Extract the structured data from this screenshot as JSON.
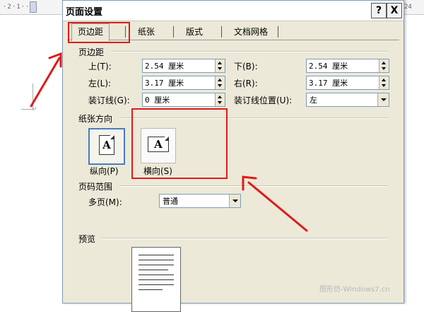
{
  "ruler": {
    "left_ticks": "·2·1··",
    "right_ticks": "24"
  },
  "dialog": {
    "title": "页面设置",
    "help_label": "?",
    "close_label": "X",
    "tabs": [
      {
        "label": "页边距",
        "active": true
      },
      {
        "label": "纸张"
      },
      {
        "label": "版式"
      },
      {
        "label": "文档网格"
      }
    ],
    "margins": {
      "section_title": "页边距",
      "top": {
        "label": "上(T):",
        "value": "2.54 厘米"
      },
      "bottom": {
        "label": "下(B):",
        "value": "2.54 厘米"
      },
      "left": {
        "label": "左(L):",
        "value": "3.17 厘米"
      },
      "right": {
        "label": "右(R):",
        "value": "3.17 厘米"
      },
      "gutter": {
        "label": "装订线(G):",
        "value": "0 厘米"
      },
      "gutter_pos": {
        "label": "装订线位置(U):",
        "value": "左"
      }
    },
    "orientation": {
      "section_title": "纸张方向",
      "portrait_label": "纵向(P)",
      "landscape_label": "横向(S)",
      "icon_glyph": "A"
    },
    "pages": {
      "section_title": "页码范围",
      "multiple_label": "多页(M):",
      "multiple_value": "普通"
    },
    "preview": {
      "section_title": "预览"
    }
  },
  "watermark": "图形仿-Windows7.cn",
  "colors": {
    "annotation": "#e01a1a",
    "dialog_bg": "#ece9d8",
    "selected_border": "#4a7cbf"
  }
}
